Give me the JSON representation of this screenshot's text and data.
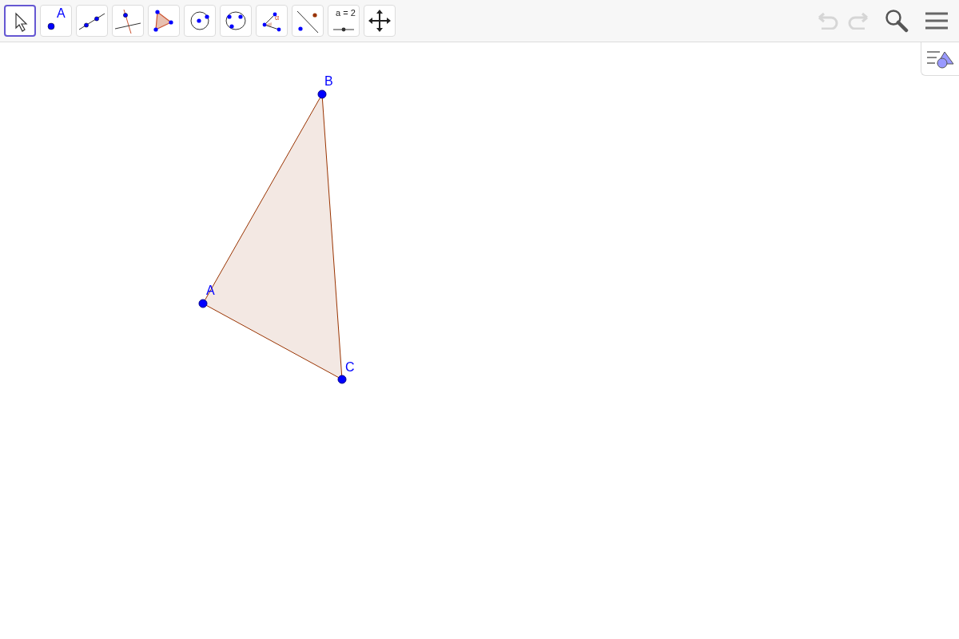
{
  "toolbar": {
    "tools": [
      {
        "kind": "move",
        "selected": true
      },
      {
        "kind": "point",
        "selected": false,
        "label": "A"
      },
      {
        "kind": "line",
        "selected": false
      },
      {
        "kind": "perpendicular",
        "selected": false
      },
      {
        "kind": "polygon",
        "selected": false
      },
      {
        "kind": "circle",
        "selected": false
      },
      {
        "kind": "conic",
        "selected": false
      },
      {
        "kind": "angle",
        "selected": false,
        "label": "α"
      },
      {
        "kind": "reflect",
        "selected": false
      },
      {
        "kind": "slider",
        "selected": false,
        "label": "a = 2"
      },
      {
        "kind": "pan",
        "selected": false
      }
    ],
    "undo": {
      "disabled": true
    },
    "redo": {
      "disabled": true
    }
  },
  "canvas": {
    "points": [
      {
        "label": "A"
      },
      {
        "label": "B"
      },
      {
        "label": "C"
      }
    ]
  }
}
